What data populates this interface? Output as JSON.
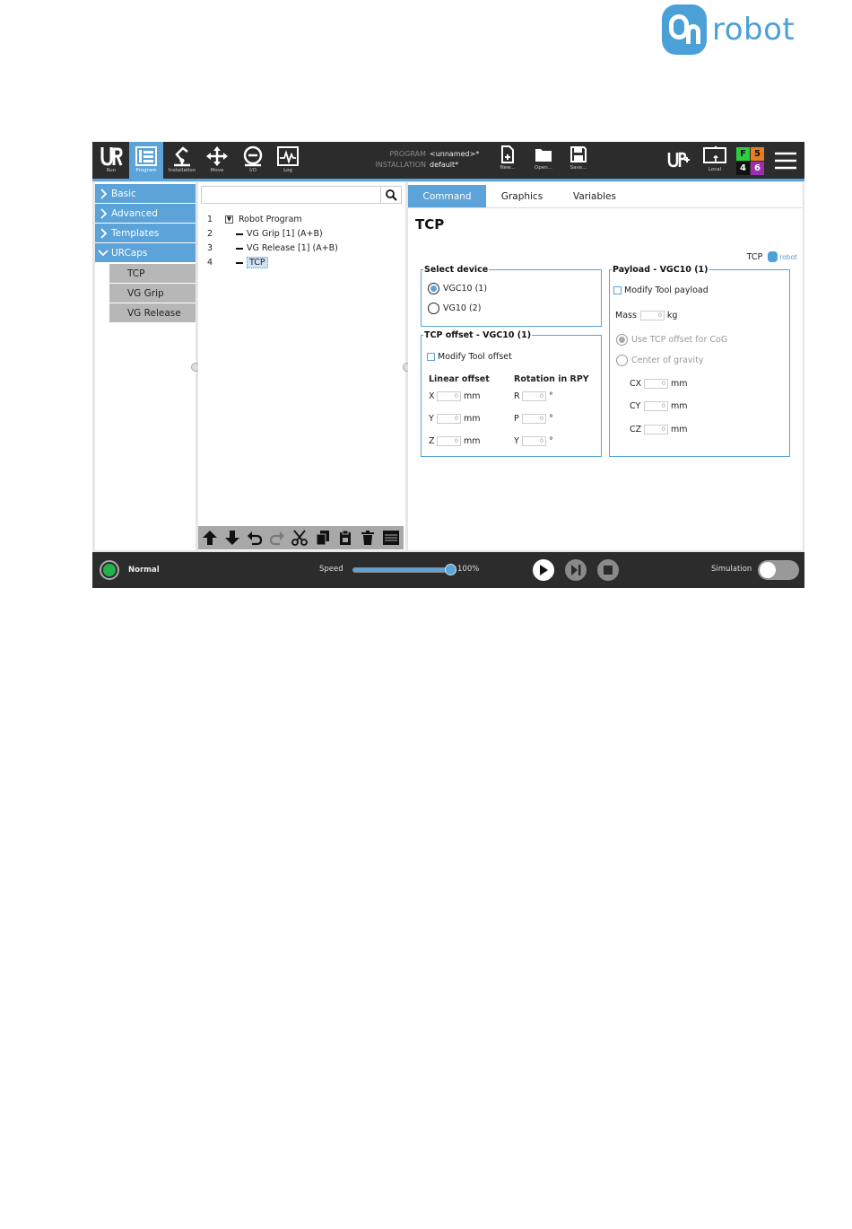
{
  "logo": {
    "text": "robot"
  },
  "nav": [
    {
      "label": "Run",
      "icon": "ur-logo-icon"
    },
    {
      "label": "Program",
      "icon": "program-icon",
      "active": true
    },
    {
      "label": "Installation",
      "icon": "installation-icon"
    },
    {
      "label": "Move",
      "icon": "move-icon"
    },
    {
      "label": "I/O",
      "icon": "io-icon"
    },
    {
      "label": "Log",
      "icon": "log-icon"
    }
  ],
  "program_info": {
    "program_key": "PROGRAM",
    "program_value": "<unnamed>*",
    "installation_key": "INSTALLATION",
    "installation_value": "default*"
  },
  "file_buttons": {
    "new": "New...",
    "open": "Open...",
    "save": "Save..."
  },
  "local_label": "Local",
  "status_grid": {
    "f": "F",
    "five": "5",
    "four": "4",
    "six": "6",
    "colors": {
      "f": "#2ecc40",
      "five": "#e67e22",
      "four": "#111111",
      "six": "#9b2fae"
    }
  },
  "sidebar": {
    "items": [
      {
        "label": "Basic"
      },
      {
        "label": "Advanced"
      },
      {
        "label": "Templates"
      },
      {
        "label": "URCaps"
      }
    ],
    "subitems": [
      {
        "label": "TCP"
      },
      {
        "label": "VG Grip"
      },
      {
        "label": "VG Release"
      }
    ]
  },
  "tree": {
    "rows": [
      {
        "num": "1",
        "label": "Robot Program"
      },
      {
        "num": "2",
        "label": "VG Grip [1] (A+B)"
      },
      {
        "num": "3",
        "label": "VG Release [1] (A+B)"
      },
      {
        "num": "4",
        "label": "TCP"
      }
    ]
  },
  "tabs": [
    {
      "label": "Command"
    },
    {
      "label": "Graphics"
    },
    {
      "label": "Variables"
    }
  ],
  "main": {
    "title": "TCP",
    "tag": "TCP",
    "tag_logo_text": "robot",
    "select_device": {
      "legend": "Select device",
      "options": [
        "VGC10 (1)",
        "VG10 (2)"
      ],
      "selected": "VGC10 (1)"
    },
    "tcp_offset": {
      "legend": "TCP offset - VGC10 (1)",
      "modify_label": "Modify Tool offset",
      "linear_header": "Linear offset",
      "rotation_header": "Rotation in RPY",
      "linear": [
        {
          "axis": "X",
          "value": "0",
          "unit": "mm"
        },
        {
          "axis": "Y",
          "value": "0",
          "unit": "mm"
        },
        {
          "axis": "Z",
          "value": "0",
          "unit": "mm"
        }
      ],
      "rotation": [
        {
          "axis": "R",
          "value": "0",
          "unit": "°"
        },
        {
          "axis": "P",
          "value": "0",
          "unit": "°"
        },
        {
          "axis": "Y",
          "value": "0",
          "unit": "°"
        }
      ]
    },
    "payload": {
      "legend": "Payload - VGC10 (1)",
      "modify_label": "Modify Tool payload",
      "mass_label": "Mass",
      "mass_value": "0",
      "mass_unit": "kg",
      "option_cog": "Use TCP offset for CoG",
      "option_center": "Center of gravity",
      "cog": [
        {
          "axis": "CX",
          "value": "0",
          "unit": "mm"
        },
        {
          "axis": "CY",
          "value": "0",
          "unit": "mm"
        },
        {
          "axis": "CZ",
          "value": "0",
          "unit": "mm"
        }
      ]
    }
  },
  "bottom": {
    "status": "Normal",
    "speed_label": "Speed",
    "speed_value": "100%",
    "speed_fraction": 1.0,
    "simulation_label": "Simulation",
    "simulation_on": false
  }
}
